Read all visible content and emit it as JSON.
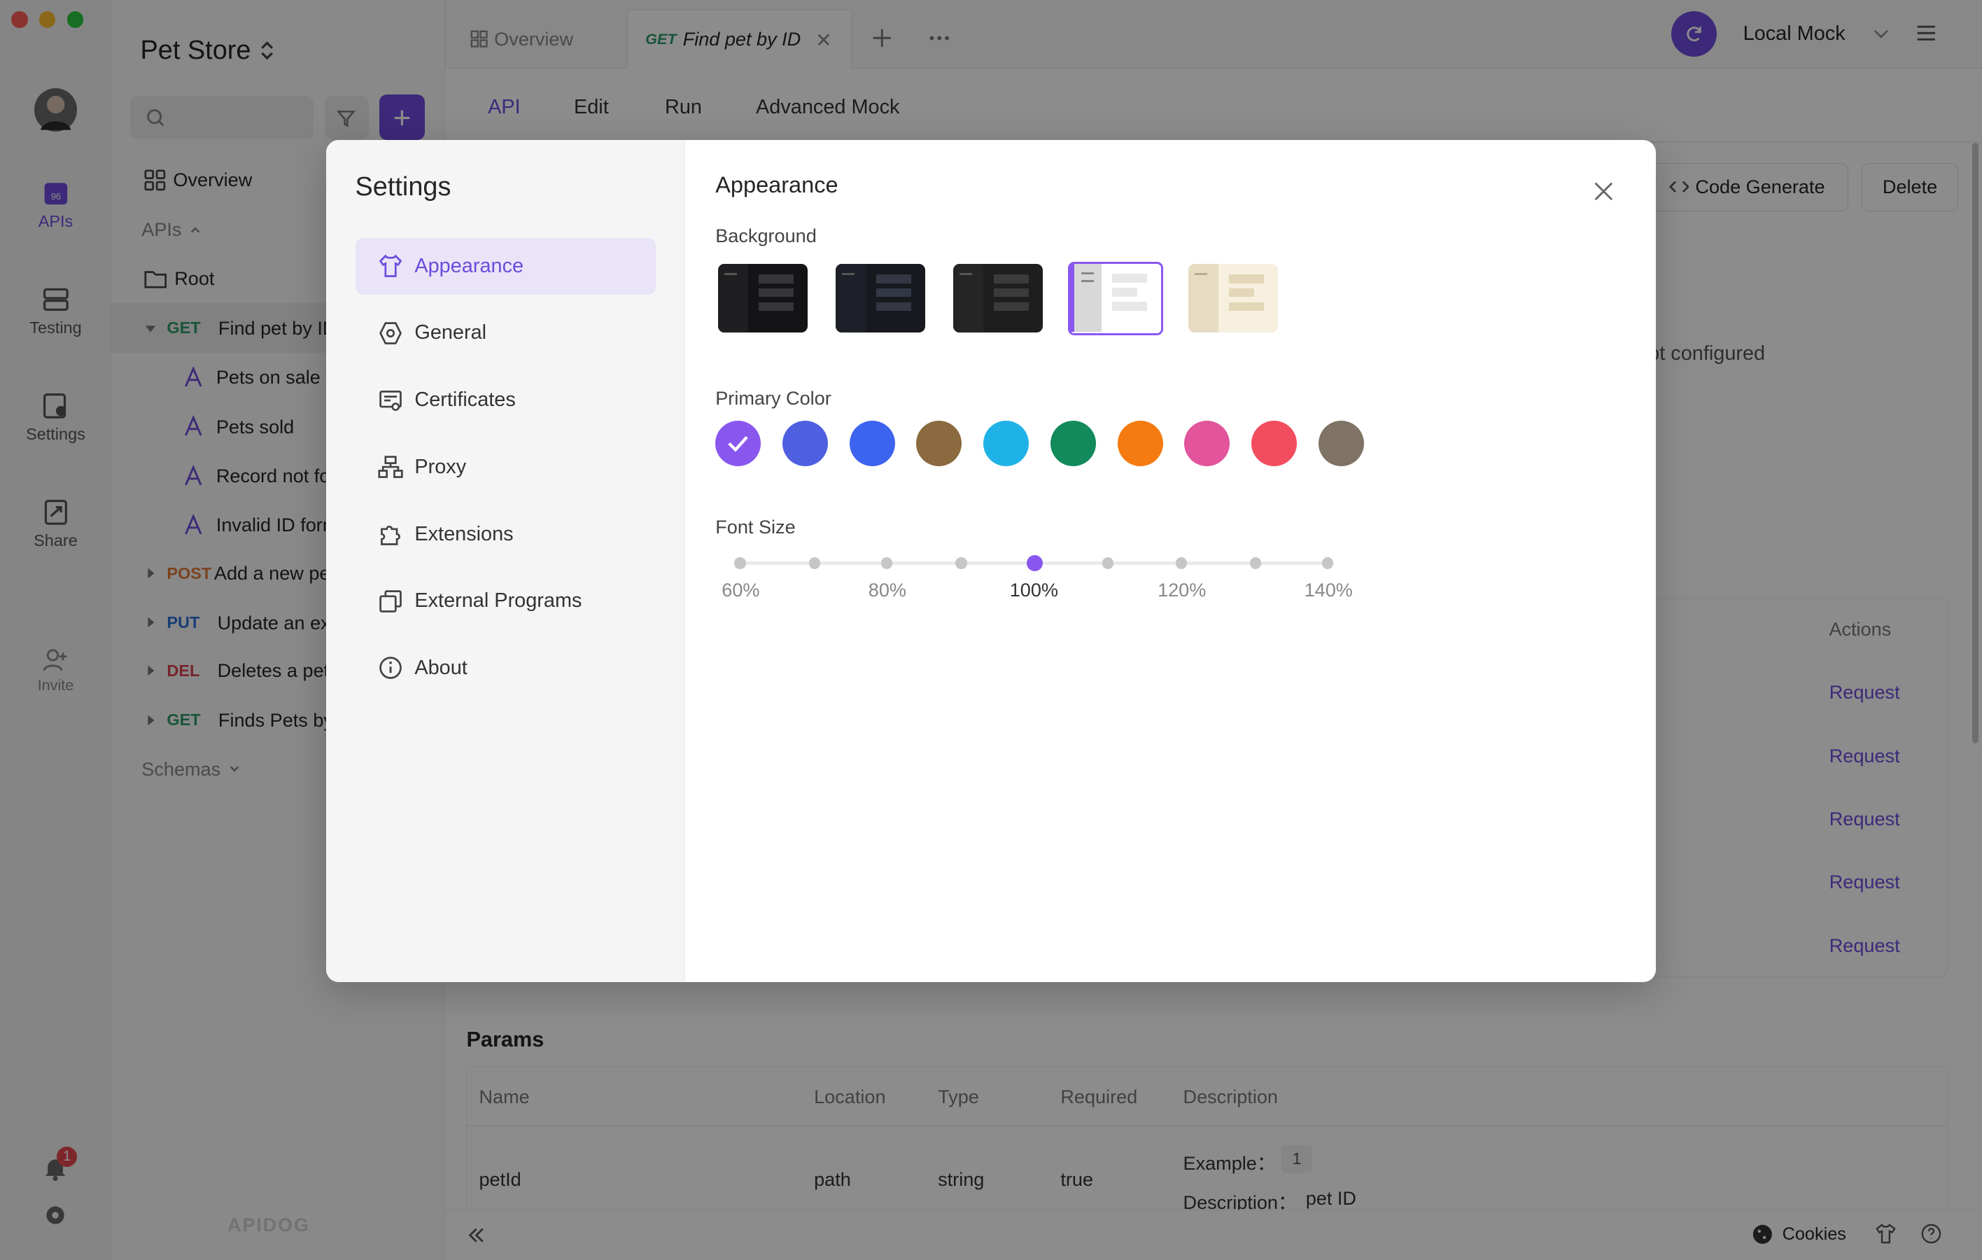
{
  "colors": {
    "accent": "#6d4cdc",
    "get": "#2e9a6b",
    "post": "#e07b39",
    "put": "#2f6fd3",
    "del": "#d9434f"
  },
  "rail": {
    "items": [
      {
        "label": "APIs"
      },
      {
        "label": "Testing"
      },
      {
        "label": "Settings"
      },
      {
        "label": "Share"
      },
      {
        "label": "Invite"
      }
    ],
    "notification_count": "1"
  },
  "tree": {
    "project": "Pet Store",
    "overview": "Overview",
    "apis_label": "APIs",
    "root": "Root",
    "endpoint_open": {
      "method": "GET",
      "name": "Find pet by ID"
    },
    "cases": [
      "Pets on sale",
      "Pets sold",
      "Record not found",
      "Invalid ID format"
    ],
    "endpoints": [
      {
        "method": "POST",
        "name": "Add a new pet"
      },
      {
        "method": "PUT",
        "name": "Update an existing pet"
      },
      {
        "method": "DEL",
        "name": "Deletes a pet"
      },
      {
        "method": "GET",
        "name": "Finds Pets by status"
      }
    ],
    "schemas": "Schemas",
    "brand": "APIDOG"
  },
  "topbar": {
    "tab_overview": "Overview",
    "tab_active_method": "GET",
    "tab_active_title": "Find pet by ID",
    "env": "Local Mock"
  },
  "subtabs": [
    "API",
    "Edit",
    "Run",
    "Advanced Mock"
  ],
  "actions": {
    "code_generate": "Code Generate",
    "delete": "Delete"
  },
  "status_text": "ot configured",
  "examples_header": "Actions",
  "request_label": "Request",
  "params": {
    "title": "Params",
    "columns": [
      "Name",
      "Location",
      "Type",
      "Required",
      "Description"
    ],
    "row": {
      "name": "petId",
      "location": "path",
      "type": "string",
      "required": "true",
      "example_label": "Example：",
      "example_value": "1",
      "desc_label": "Description：",
      "desc_value": "pet ID"
    }
  },
  "footer": {
    "cookies": "Cookies"
  },
  "settings": {
    "title": "Settings",
    "menu": [
      "Appearance",
      "General",
      "Certificates",
      "Proxy",
      "Extensions",
      "External Programs",
      "About"
    ],
    "active_index": 0,
    "appearance": {
      "heading": "Appearance",
      "background_label": "Background",
      "backgrounds": [
        {
          "name": "dark-1",
          "color": "#141416"
        },
        {
          "name": "dark-2",
          "color": "#17191f"
        },
        {
          "name": "dark-3",
          "color": "#1e1e1e"
        },
        {
          "name": "light",
          "color": "#ffffff"
        },
        {
          "name": "sepia",
          "color": "#f7f0df"
        }
      ],
      "selected_background": 3,
      "primary_color_label": "Primary Color",
      "primary_colors": [
        "#8a57ee",
        "#4e5fe0",
        "#3d64ee",
        "#8a6a3e",
        "#1fb2e6",
        "#128a5c",
        "#f57a10",
        "#e2549b",
        "#f24d5f",
        "#7e7364"
      ],
      "selected_color": 0,
      "font_size_label": "Font Size",
      "font_size_labels": [
        "60%",
        "80%",
        "100%",
        "120%",
        "140%"
      ],
      "font_size_value": "100%"
    }
  }
}
